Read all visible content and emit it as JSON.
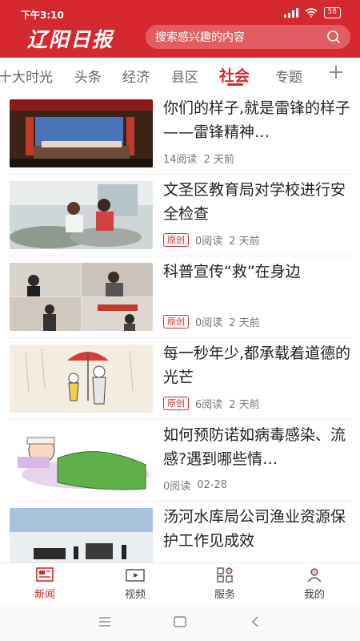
{
  "status": {
    "time": "下午3:10",
    "battery": "58"
  },
  "header": {
    "logo": "辽阳日报",
    "search_placeholder": "搜索感兴趣的内容"
  },
  "tabs": [
    {
      "label": "十大时光"
    },
    {
      "label": "头条"
    },
    {
      "label": "经济"
    },
    {
      "label": "县区"
    },
    {
      "label": "社会"
    },
    {
      "label": "专题"
    }
  ],
  "active_tab": "社会",
  "feed": [
    {
      "title": "你们的样子,就是雷锋的样子——雷锋精神…",
      "badge": "",
      "reads": "14阅读",
      "time": "2 天前"
    },
    {
      "title": "文圣区教育局对学校进行安全检查",
      "badge": "原创",
      "reads": "0阅读",
      "time": "2 天前"
    },
    {
      "title": "科普宣传“救”在身边",
      "badge": "原创",
      "reads": "0阅读",
      "time": "2 天前"
    },
    {
      "title": "每一秒年少,都承载着道德的光芒",
      "badge": "原创",
      "reads": "6阅读",
      "time": "2 天前"
    },
    {
      "title": "如何预防诺如病毒感染、流感?遇到哪些情…",
      "badge": "",
      "reads": "0阅读",
      "time": "02-28"
    },
    {
      "title": "汤河水库局公司渔业资源保护工作见成效",
      "badge": "",
      "reads": "",
      "time": ""
    }
  ],
  "bottom_nav": [
    {
      "label": "新闻"
    },
    {
      "label": "视频"
    },
    {
      "label": "服务"
    },
    {
      "label": "我的"
    }
  ],
  "colors": {
    "brand": "#d6282f"
  }
}
